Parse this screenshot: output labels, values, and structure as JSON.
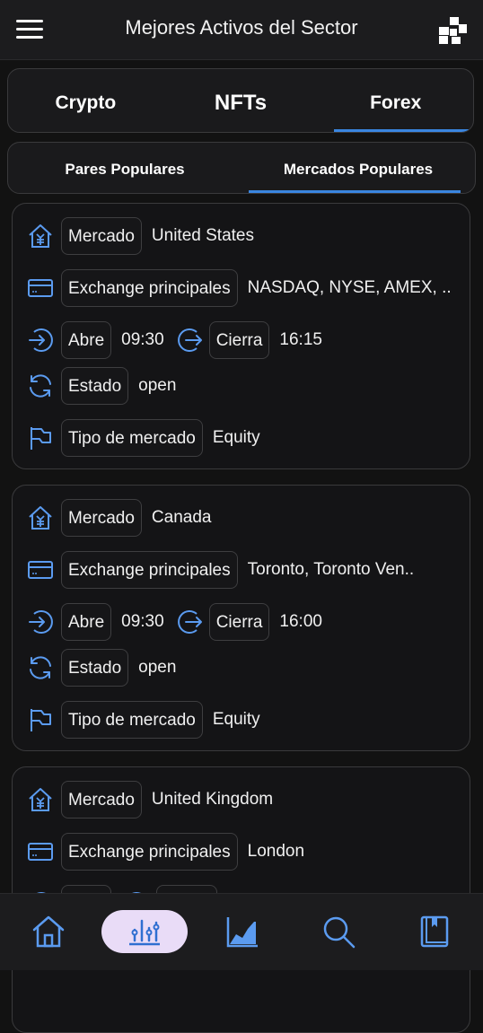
{
  "header": {
    "title": "Mejores Activos del Sector"
  },
  "tabs": [
    {
      "label": "Crypto"
    },
    {
      "label": "NFTs"
    },
    {
      "label": "Forex"
    }
  ],
  "subtabs": [
    {
      "label": "Pares Populares"
    },
    {
      "label": "Mercados Populares"
    }
  ],
  "accent_color": "#3a86e0",
  "labels": {
    "market": "Mercado",
    "exchanges": "Exchange principales",
    "opens": "Abre",
    "closes": "Cierra",
    "status": "Estado",
    "market_type": "Tipo de mercado"
  },
  "markets": [
    {
      "market": "United States",
      "exchanges": "NASDAQ, NYSE, AMEX, ..",
      "opens": "09:30",
      "closes": "16:15",
      "status": "open",
      "market_type": "Equity"
    },
    {
      "market": "Canada",
      "exchanges": "Toronto, Toronto Ven..",
      "opens": "09:30",
      "closes": "16:00",
      "status": "open",
      "market_type": "Equity"
    },
    {
      "market": "United Kingdom",
      "exchanges": "London"
    }
  ],
  "icons": {
    "header_left": "menu-icon",
    "header_right": "grid-icon",
    "bottom_nav": [
      "home-icon",
      "stats-icon",
      "area-chart-icon",
      "search-icon",
      "book-icon"
    ]
  }
}
